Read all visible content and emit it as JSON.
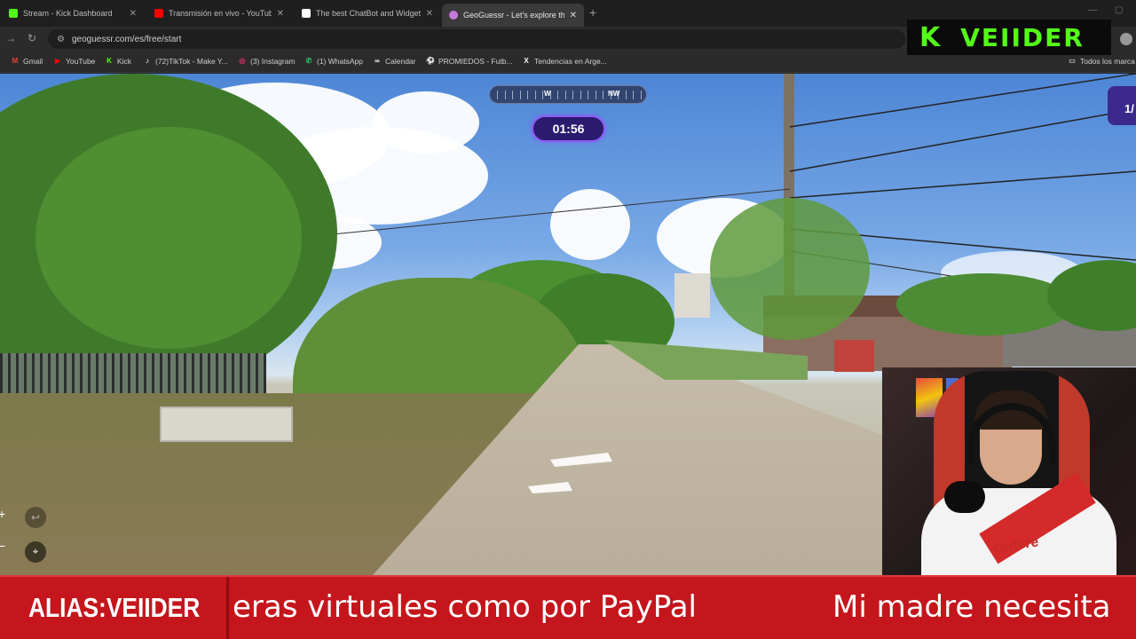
{
  "browser": {
    "tabs": [
      {
        "title": "Stream - Kick Dashboard",
        "active": false,
        "color": "#53fc18"
      },
      {
        "title": "Transmisión en vivo - YouTube",
        "active": false,
        "color": "#ff0000"
      },
      {
        "title": "The best ChatBot and Widgets",
        "active": false,
        "color": "#ffffff"
      },
      {
        "title": "GeoGuessr - Let's explore the w",
        "active": true,
        "color": "#c678dd"
      }
    ],
    "new_tab_label": "+",
    "url": "geoguessr.com/es/free/start",
    "bookmarks": [
      {
        "label": "Gmail",
        "icon": "gmail-icon",
        "glyph": "M",
        "color": "#ea4335"
      },
      {
        "label": "YouTube",
        "icon": "youtube-icon",
        "glyph": "▶",
        "color": "#ff0000"
      },
      {
        "label": "Kick",
        "icon": "kick-icon",
        "glyph": "K",
        "color": "#53fc18"
      },
      {
        "label": "(72)TikTok - Make Y...",
        "icon": "tiktok-icon",
        "glyph": "♪",
        "color": "#ffffff"
      },
      {
        "label": "(3) Instagram",
        "icon": "instagram-icon",
        "glyph": "◎",
        "color": "#e1306c"
      },
      {
        "label": "(1) WhatsApp",
        "icon": "whatsapp-icon",
        "glyph": "✆",
        "color": "#25d366"
      },
      {
        "label": "Calendar",
        "icon": "calendar-icon",
        "glyph": "∞",
        "color": "#ffffff"
      },
      {
        "label": "PROMIEDOS - Futb...",
        "icon": "promiedos-icon",
        "glyph": "⚽",
        "color": "#7ed957"
      },
      {
        "label": "Tendencias en Arge...",
        "icon": "x-icon",
        "glyph": "X",
        "color": "#ffffff"
      }
    ],
    "all_bookmarks_label": "Todos los marca"
  },
  "overlay": {
    "logo_letter": "K",
    "channel_name": "VEIIDER",
    "accent": "#53fc18"
  },
  "game": {
    "compass_left": "W",
    "compass_right": "NW",
    "timer": "01:56",
    "round_number": "1/",
    "zoom_in": "+",
    "zoom_out": "−",
    "accent": "#8d5cf6"
  },
  "webcam": {
    "shirt_sponsor": "codere"
  },
  "ticker": {
    "alias": "ALIAS:VEIIDER",
    "scroll_text_1": "eras virtuales como por PayPal",
    "scroll_text_2": "Mi madre necesita",
    "color": "#c4161c"
  }
}
